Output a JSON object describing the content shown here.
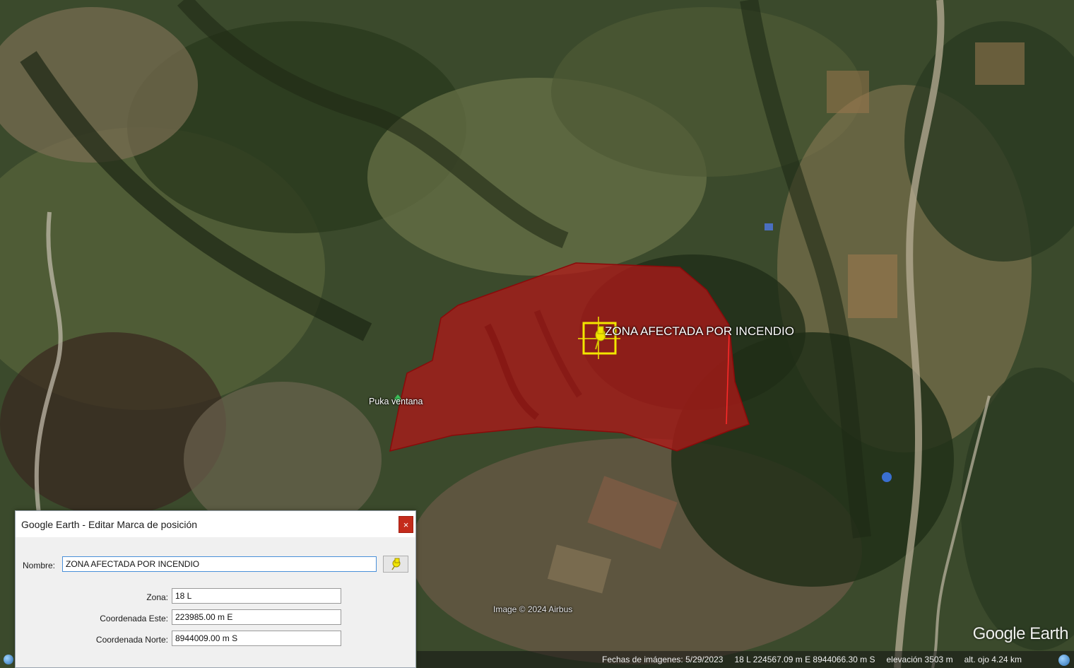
{
  "map": {
    "placemark_label": "ZONA AFECTADA POR INCENDIO",
    "secondary_placemark_label": "Puka ventana",
    "image_credit": "Image © 2024 Airbus",
    "logo": "Google Earth",
    "polygon_fill_color": "#b01818",
    "pin_color": "#f2e600"
  },
  "statusbar": {
    "imagery_date": "Fechas de imágenes: 5/29/2023",
    "coordinates": "18 L 224567.09 m E 8944066.30 m S",
    "elevation": "elevación   3503 m",
    "eye_altitude": "alt. ojo   4.24 km"
  },
  "dialog": {
    "title": "Google Earth - Editar Marca de posición",
    "close_label": "×",
    "name_label": "Nombre:",
    "name_value": "ZONA AFECTADA POR INCENDIO",
    "zone_label": "Zona:",
    "zone_value": "18 L",
    "east_label": "Coordenada Este:",
    "east_value": "223985.00 m E",
    "north_label": "Coordenada Norte:",
    "north_value": "8944009.00 m S",
    "pin_icon": "pushpin-icon"
  }
}
